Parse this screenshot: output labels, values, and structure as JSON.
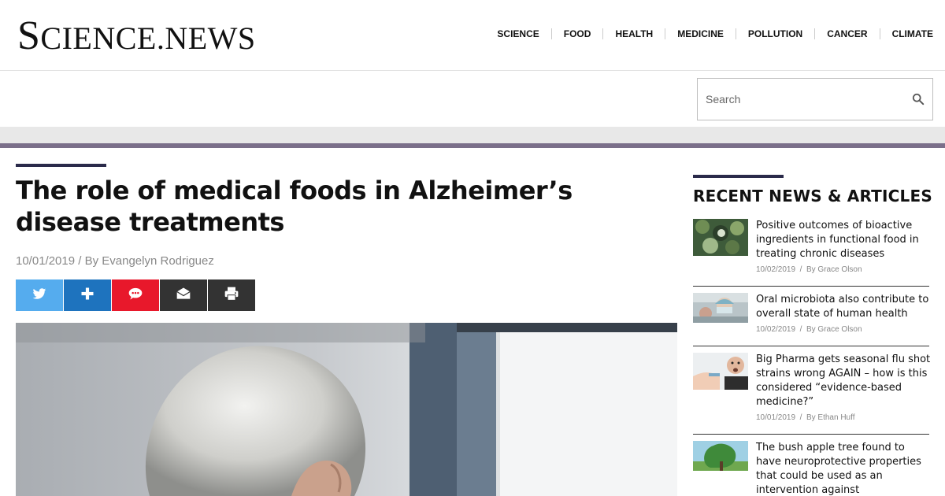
{
  "site": {
    "logo_first": "S",
    "logo_rest": "CIENCE.NEWS"
  },
  "nav": {
    "items": [
      "SCIENCE",
      "FOOD",
      "HEALTH",
      "MEDICINE",
      "POLLUTION",
      "CANCER",
      "CLIMATE"
    ]
  },
  "search": {
    "placeholder": "Search"
  },
  "article": {
    "title": "The role of medical foods in Alzheimer’s disease treatments",
    "date": "10/01/2019",
    "byline": "By Evangelyn Rodriguez",
    "share_buttons": [
      {
        "name": "twitter",
        "color": "#55acee"
      },
      {
        "name": "plus",
        "color": "#1e73be"
      },
      {
        "name": "comment",
        "color": "#e8182b"
      },
      {
        "name": "email",
        "color": "#333333"
      },
      {
        "name": "print",
        "color": "#333333"
      }
    ]
  },
  "sidebar": {
    "title": "RECENT NEWS & ARTICLES",
    "items": [
      {
        "title": "Positive outcomes of bioactive ingredients in functional food in treating chronic diseases",
        "date": "10/02/2019",
        "author": "By Grace Olson"
      },
      {
        "title": "Oral microbiota also contribute to overall state of human health",
        "date": "10/02/2019",
        "author": "By Grace Olson"
      },
      {
        "title": "Big Pharma gets seasonal flu shot strains wrong AGAIN – how is this considered “evidence-based medicine?”",
        "date": "10/01/2019",
        "author": "By Ethan Huff"
      },
      {
        "title": "The bush apple tree found to have neuroprotective properties that could be used as an intervention against",
        "date": "",
        "author": ""
      }
    ]
  },
  "colors": {
    "accent_bar": "#2a2a4a",
    "divider": "#7b6f8a"
  }
}
